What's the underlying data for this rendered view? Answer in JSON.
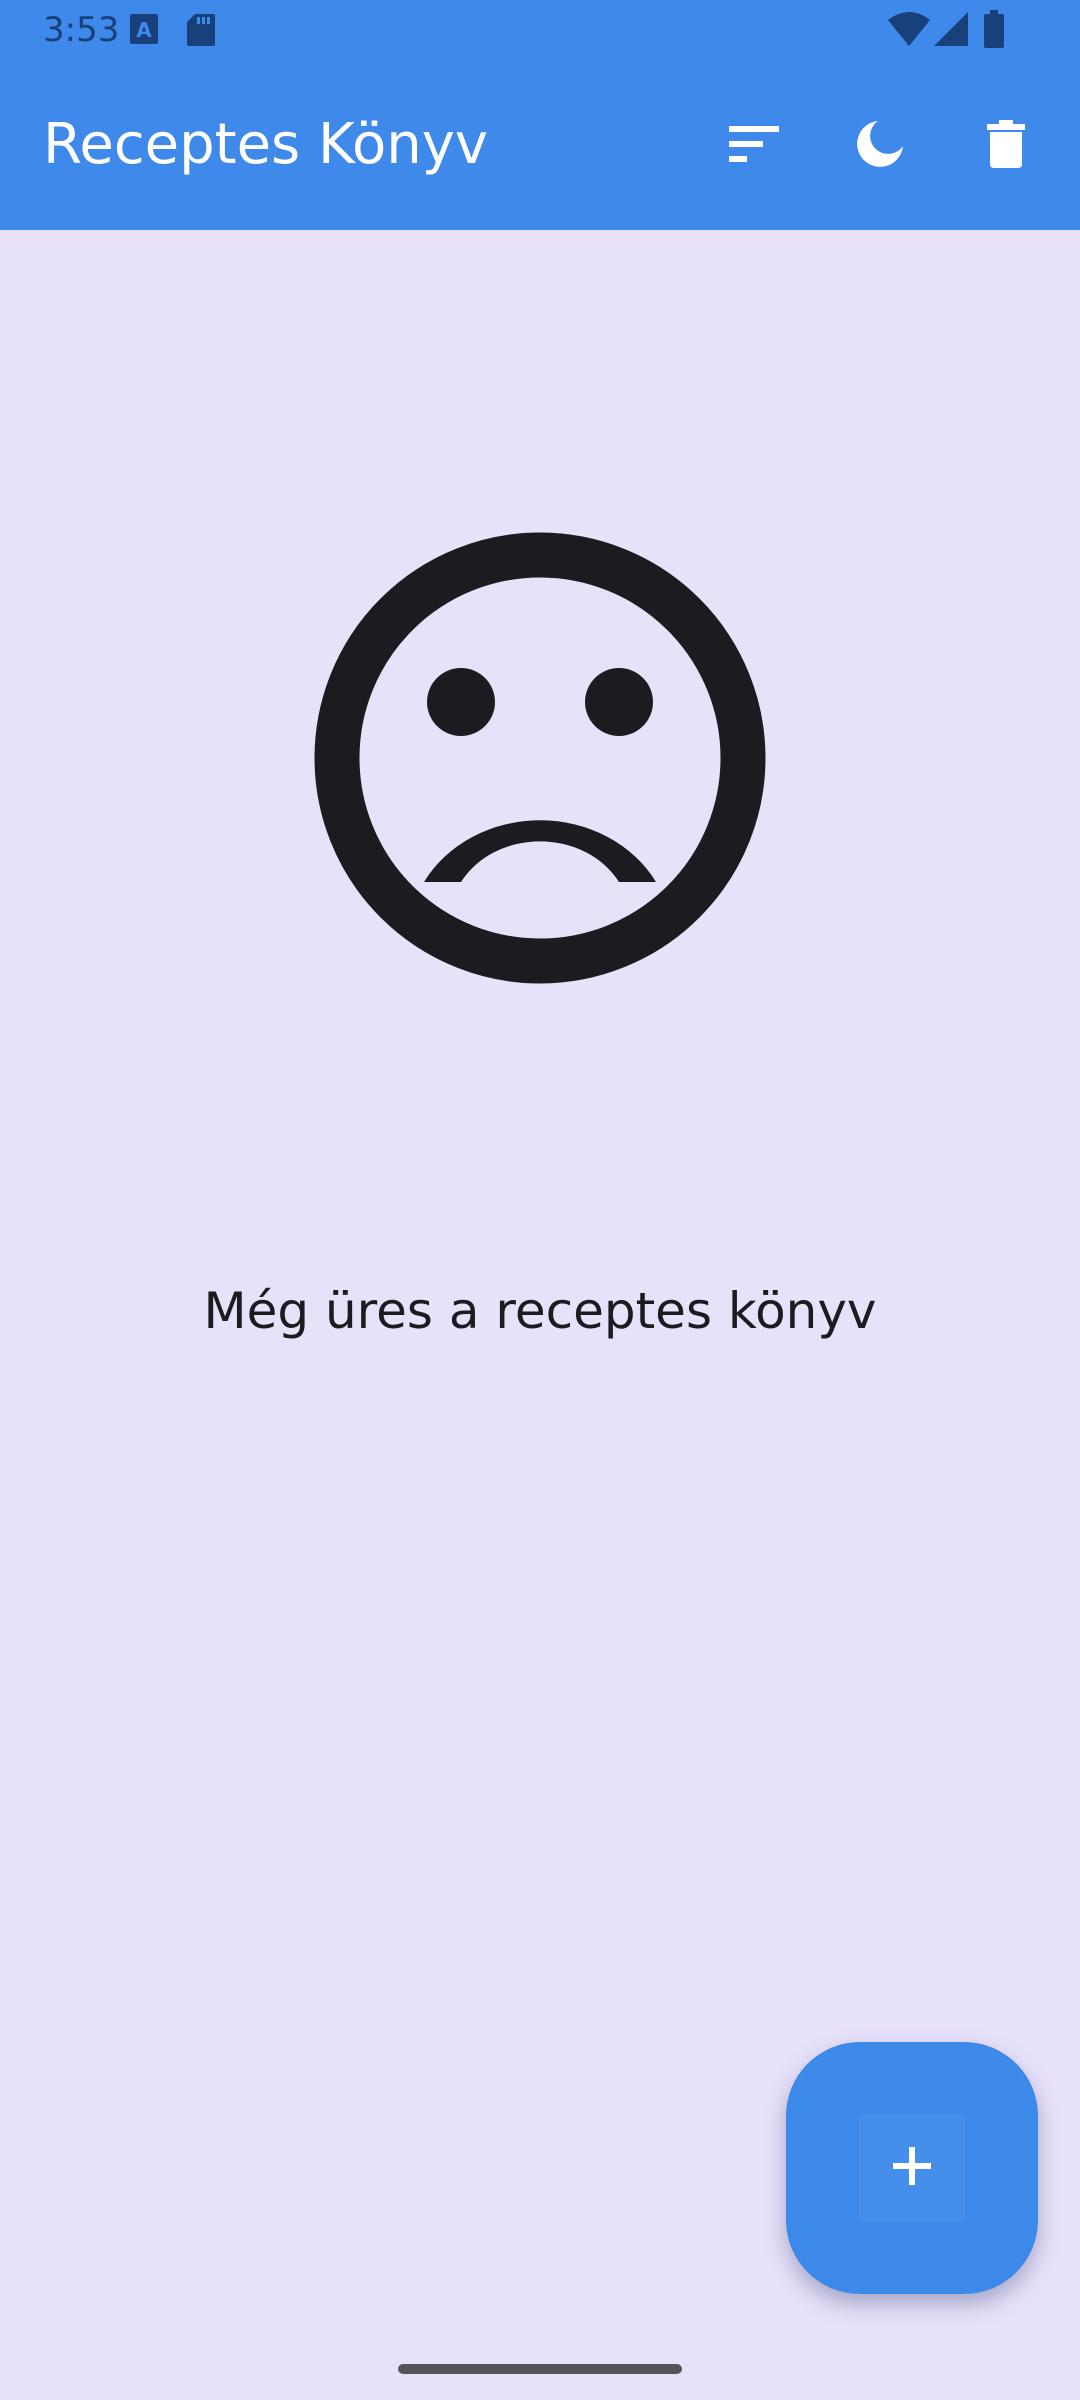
{
  "status_bar": {
    "time": "3:53",
    "icons": [
      "text-notification-icon",
      "sd-card-icon",
      "wifi-icon",
      "cell-signal-icon",
      "battery-icon"
    ],
    "background": "#3F89EA",
    "foreground": "#18407A"
  },
  "app_bar": {
    "title": "Receptes Könyv",
    "background": "#3F89EA",
    "actions": [
      "sort-icon",
      "dark-mode-icon",
      "delete-icon"
    ]
  },
  "empty_state": {
    "icon": "sad-face-icon",
    "message": "Még üres a receptes könyv"
  },
  "fab": {
    "icon": "plus-icon",
    "color": "#3C89EA"
  },
  "colors": {
    "background": "#E8E1FA",
    "text": "#1D1B20"
  }
}
